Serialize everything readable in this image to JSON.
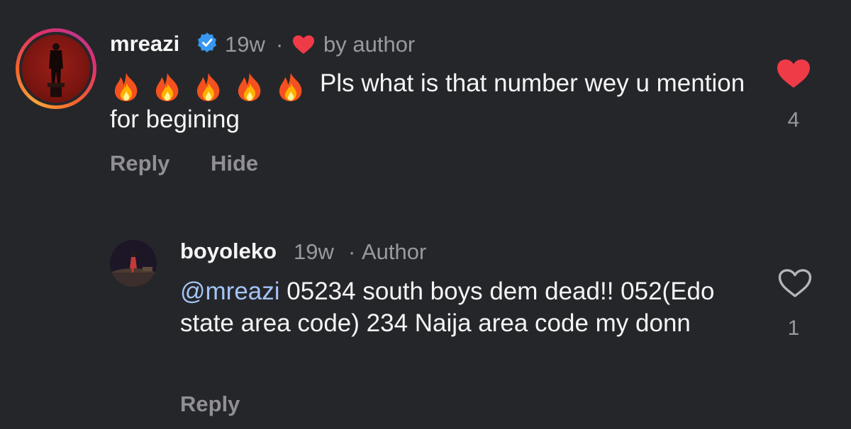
{
  "main_comment": {
    "username": "mreazi",
    "time": "19w",
    "separator": "·",
    "liked_by": "by author",
    "emoji_count": 5,
    "text": "Pls what is that number wey u mention for begining",
    "actions": {
      "reply": "Reply",
      "hide": "Hide"
    },
    "likes": "4",
    "liked": true
  },
  "reply_comment": {
    "username": "boyoleko",
    "time": "19w",
    "separator": "·",
    "author_label": "Author",
    "mention": "@mreazi",
    "text": " 05234 south boys dem dead!! 052(Edo state area code) 234 Naija area code my donn",
    "actions": {
      "reply": "Reply"
    },
    "likes": "1",
    "liked": false
  },
  "colors": {
    "background": "#25262a",
    "like_red": "#ef3a47",
    "verified_blue": "#3897f0",
    "mention_blue": "#a3c4f5",
    "muted": "#9a9a9e"
  }
}
